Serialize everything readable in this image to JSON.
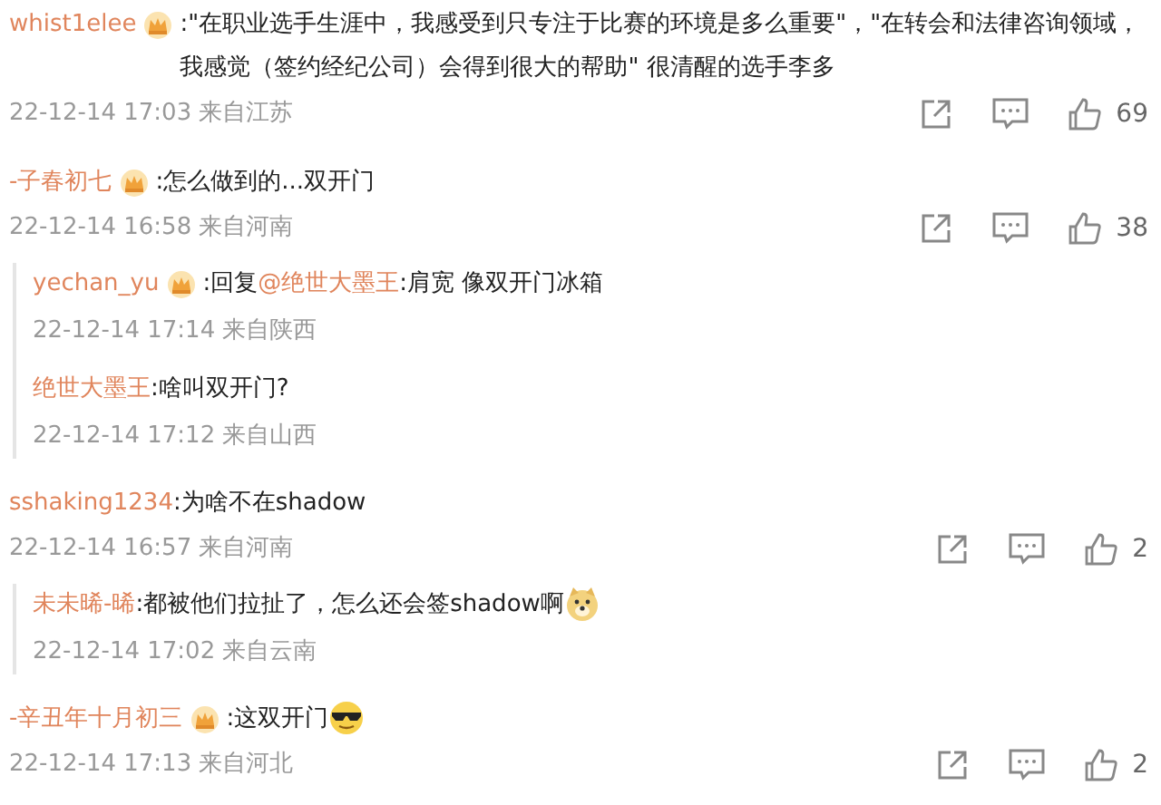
{
  "comments": [
    {
      "user": "whist1elee",
      "badge": true,
      "parts": [
        {
          "kind": "plain",
          "text": ":\"在职业选手生涯中，我感受到只专注于比赛的环境是多么重要\"，\"在转会和法律咨询领域，我感觉（签约经纪公司）会得到很大的帮助\" 很清醒的选手李多"
        }
      ],
      "meta": "22-12-14 17:03 来自江苏",
      "likes": "69"
    },
    {
      "user": "-子春初七",
      "badge": true,
      "parts": [
        {
          "kind": "plain",
          "text": ":怎么做到的...双开门"
        }
      ],
      "meta": "22-12-14 16:58 来自河南",
      "likes": "38",
      "replies": [
        {
          "user": "yechan_yu",
          "badge": true,
          "parts": [
            {
              "kind": "plain",
              "text": ":回复"
            },
            {
              "kind": "mention",
              "text": "@绝世大墨王"
            },
            {
              "kind": "plain",
              "text": ":肩宽 像双开门冰箱"
            }
          ],
          "meta": "22-12-14 17:14 来自陕西"
        },
        {
          "user": "绝世大墨王",
          "badge": false,
          "parts": [
            {
              "kind": "plain",
              "text": ":啥叫双开门?"
            }
          ],
          "meta": "22-12-14 17:12 来自山西"
        }
      ]
    },
    {
      "user": "sshaking1234",
      "badge": false,
      "parts": [
        {
          "kind": "plain",
          "text": ":为啥不在shadow"
        }
      ],
      "meta": "22-12-14 16:57 来自河南",
      "likes": "2",
      "replies": [
        {
          "user": "未未晞-晞",
          "badge": false,
          "parts": [
            {
              "kind": "plain",
              "text": ":都被他们拉扯了，怎么还会签shadow啊"
            },
            {
              "kind": "doge"
            }
          ],
          "meta": "22-12-14 17:02 来自云南"
        }
      ]
    },
    {
      "user": "-辛丑年十月初三",
      "badge": true,
      "parts": [
        {
          "kind": "plain",
          "text": ":这双开门"
        },
        {
          "kind": "cool"
        }
      ],
      "meta": "22-12-14 17:13 来自河北",
      "likes": "2"
    }
  ]
}
